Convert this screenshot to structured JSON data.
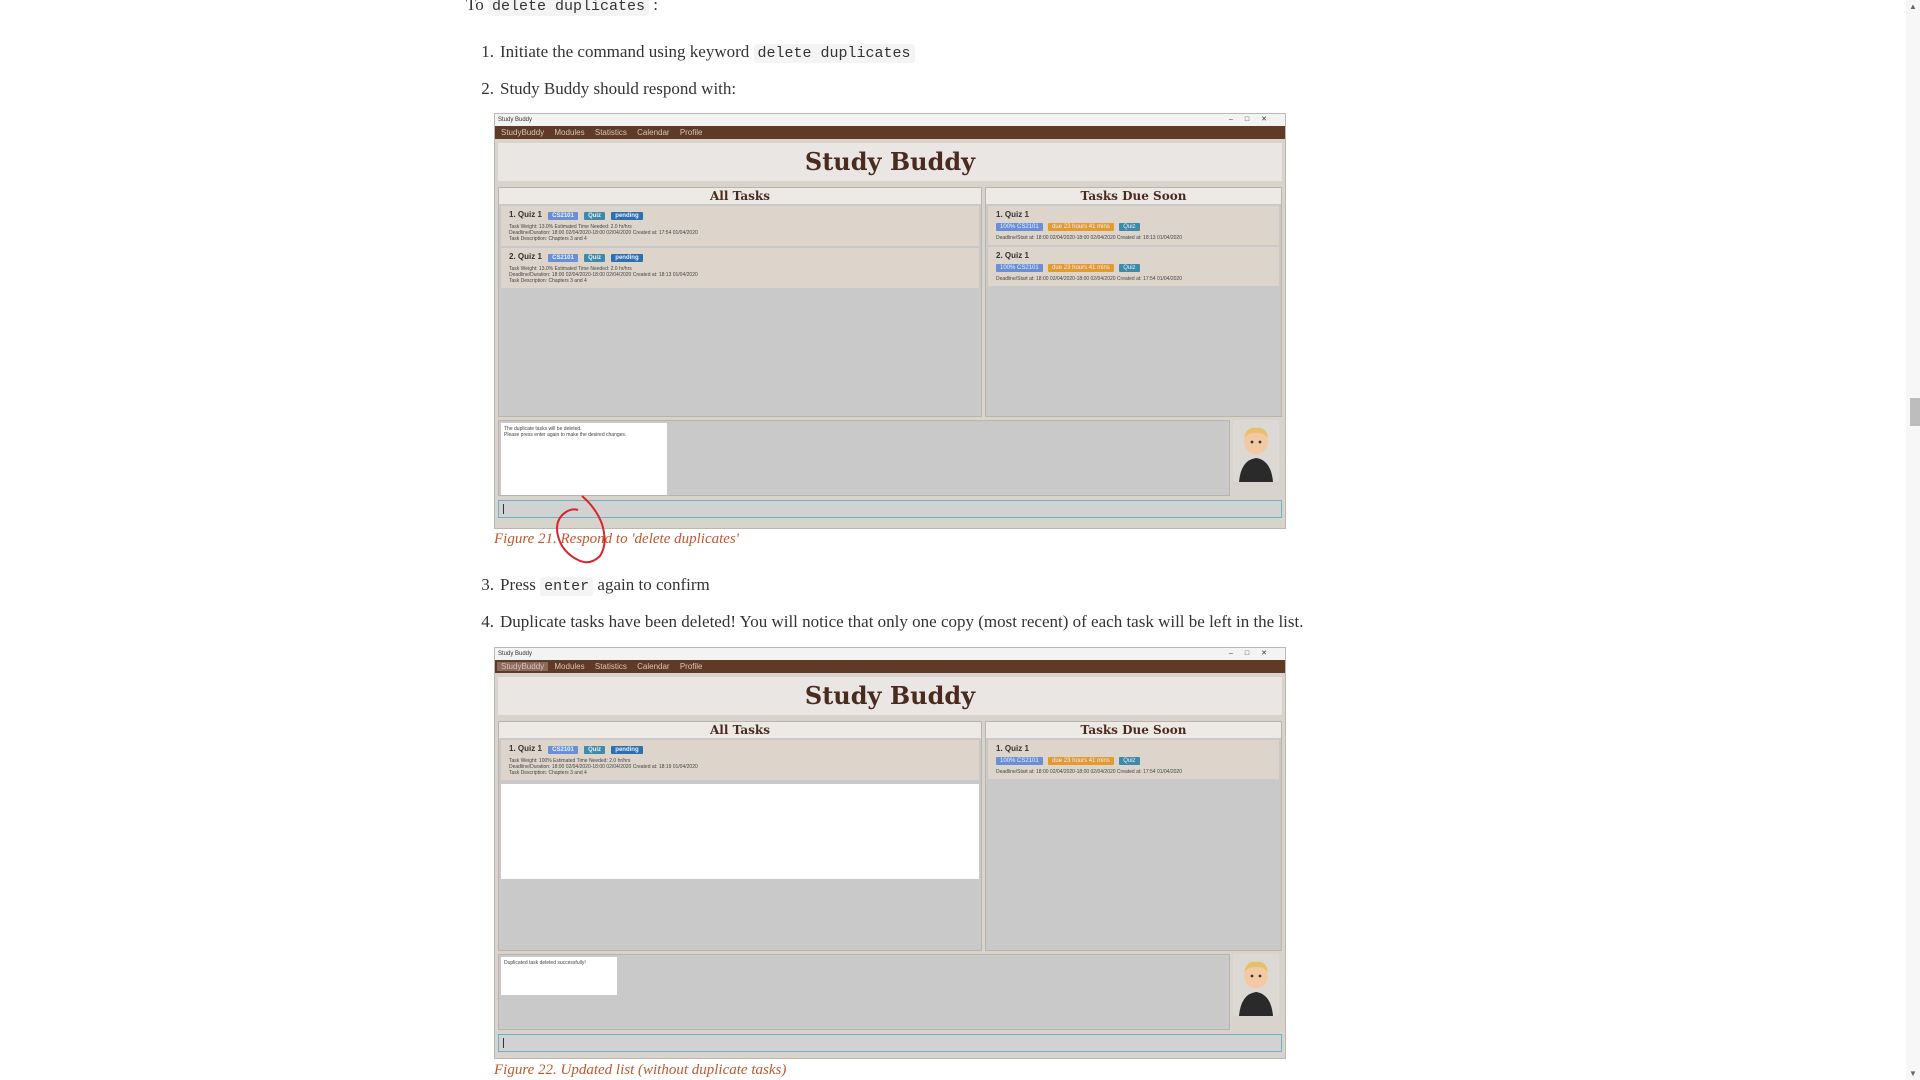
{
  "intro": {
    "prefix": "To",
    "code": "delete duplicates",
    "suffix": ":"
  },
  "steps": [
    {
      "num": "1.",
      "text": "Initiate the command using keyword",
      "code": "delete duplicates"
    },
    {
      "num": "2.",
      "text": "Study Buddy should respond with:"
    },
    {
      "num": "3.",
      "text_before": "Press",
      "code": "enter",
      "text_after": "again to confirm"
    },
    {
      "num": "4.",
      "text": "Duplicate tasks have been deleted! You will notice that only one copy (most recent) of each task will be left in the list."
    }
  ],
  "figure21": {
    "caption": "Figure 21. Respond to 'delete duplicates'",
    "window_title": "Study Buddy",
    "menu": [
      "StudyBuddy",
      "Modules",
      "Statistics",
      "Calendar",
      "Profile"
    ],
    "app_title": "Study Buddy",
    "all_tasks_title": "All Tasks",
    "due_soon_title": "Tasks Due Soon",
    "all_tasks": [
      {
        "name": "1. Quiz 1",
        "tags": [
          "CS2101",
          "Quiz",
          "pending"
        ],
        "line1": "Task Weight: 13.0%    Estimated Time Needed: 2.0 hr/hrs",
        "line2": "Deadline/Duration: 18:00 02/04/2020-18:00 02/04/2020    Created at: 17:54 01/04/2020",
        "line3": "Task Description: Chapters 3 and 4"
      },
      {
        "name": "2. Quiz 1",
        "tags": [
          "CS2101",
          "Quiz",
          "pending"
        ],
        "line1": "Task Weight: 13.0%    Estimated Time Needed: 2.0 hr/hrs",
        "line2": "Deadline/Duration: 18:00 02/04/2020-18:00 02/04/2020    Created at: 18:13 01/04/2020",
        "line3": "Task Description: Chapters 3 and 4"
      }
    ],
    "due_soon": [
      {
        "name": "1. Quiz 1",
        "tags": [
          "100% CS2101",
          "due 23 hours 41 mins",
          "Quiz"
        ],
        "line1": "Deadline/Start at: 18:00 02/04/2020-18:00 02/04/2020    Created at: 18:13 01/04/2020"
      },
      {
        "name": "2. Quiz 1",
        "tags": [
          "100% CS2101",
          "due 23 hours 41 mins",
          "Quiz"
        ],
        "line1": "Deadline/Start at: 18:00 02/04/2020-18:00 02/04/2020    Created at: 17:54 01/04/2020"
      }
    ],
    "result_line1": "The duplicate tasks will be deleted.",
    "result_line2": "Please press enter again to make the desired changes."
  },
  "figure22": {
    "caption": "Figure 22. Updated list (without duplicate tasks)",
    "window_title": "Study Buddy",
    "menu": [
      "StudyBuddy",
      "Modules",
      "Statistics",
      "Calendar",
      "Profile"
    ],
    "app_title": "Study Buddy",
    "all_tasks_title": "All Tasks",
    "due_soon_title": "Tasks Due Soon",
    "all_tasks": [
      {
        "name": "1. Quiz 1",
        "tags": [
          "CS2101",
          "Quiz",
          "pending"
        ],
        "line1": "Task Weight: 100%    Estimated Time Needed: 2.0 hr/hrs",
        "line2": "Deadline/Duration: 18:00 02/04/2020-18:00 02/04/2020    Created at: 18:19 01/04/2020",
        "line3": "Task Description: Chapters 3 and 4"
      }
    ],
    "due_soon": [
      {
        "name": "1. Quiz 1",
        "tags": [
          "100% CS2101",
          "due 23 hours 41 mins",
          "Quiz"
        ],
        "line1": "Deadline/Start at: 18:00 02/04/2020-18:00 02/04/2020    Created at: 17:54 01/04/2020"
      }
    ],
    "result_line1": "Duplicated task deleted successfully!"
  },
  "colors": {
    "caption": "#c0582d",
    "menubar": "#5e3a27",
    "annotation": "#d9232d"
  }
}
